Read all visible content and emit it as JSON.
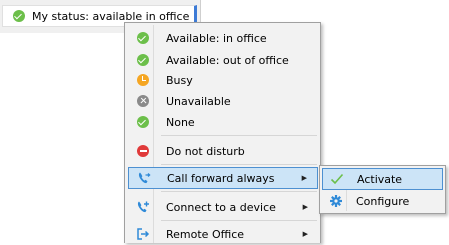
{
  "status_bar": {
    "label": "My status: available in office",
    "icon": "check-circle-icon",
    "accent": "#3d7bd6"
  },
  "menu": {
    "items": [
      {
        "label": "Available: in office",
        "icon": "check-circle-icon",
        "color": "#6cbf4a"
      },
      {
        "label": "Available: out of office",
        "icon": "check-circle-icon",
        "color": "#6cbf4a"
      },
      {
        "label": "Busy",
        "icon": "clock-icon",
        "color": "#f5a623"
      },
      {
        "label": "Unavailable",
        "icon": "x-circle-icon",
        "color": "#8a8a8a"
      },
      {
        "label": "None",
        "icon": "check-circle-icon",
        "color": "#6cbf4a"
      },
      {
        "label": "Do not disturb",
        "icon": "minus-circle-icon",
        "color": "#e03a3a"
      },
      {
        "label": "Call forward always",
        "icon": "phone-forward-icon",
        "color": "#2f8ad8",
        "has_submenu": true,
        "highlighted": true
      },
      {
        "label": "Connect to a device",
        "icon": "phone-plus-icon",
        "color": "#2f8ad8",
        "has_submenu": true
      },
      {
        "label": "Remote Office",
        "icon": "exit-icon",
        "color": "#2f8ad8",
        "has_submenu": true
      }
    ]
  },
  "submenu": {
    "items": [
      {
        "label": "Activate",
        "icon": "checkmark-icon",
        "color": "#6cbf4a",
        "highlighted": true
      },
      {
        "label": "Configure",
        "icon": "gear-icon",
        "color": "#2f8ad8"
      }
    ]
  },
  "colors": {
    "highlight_bg": "#cce4f7",
    "highlight_border": "#4d90d1",
    "menu_bg": "#f2f2f2"
  }
}
